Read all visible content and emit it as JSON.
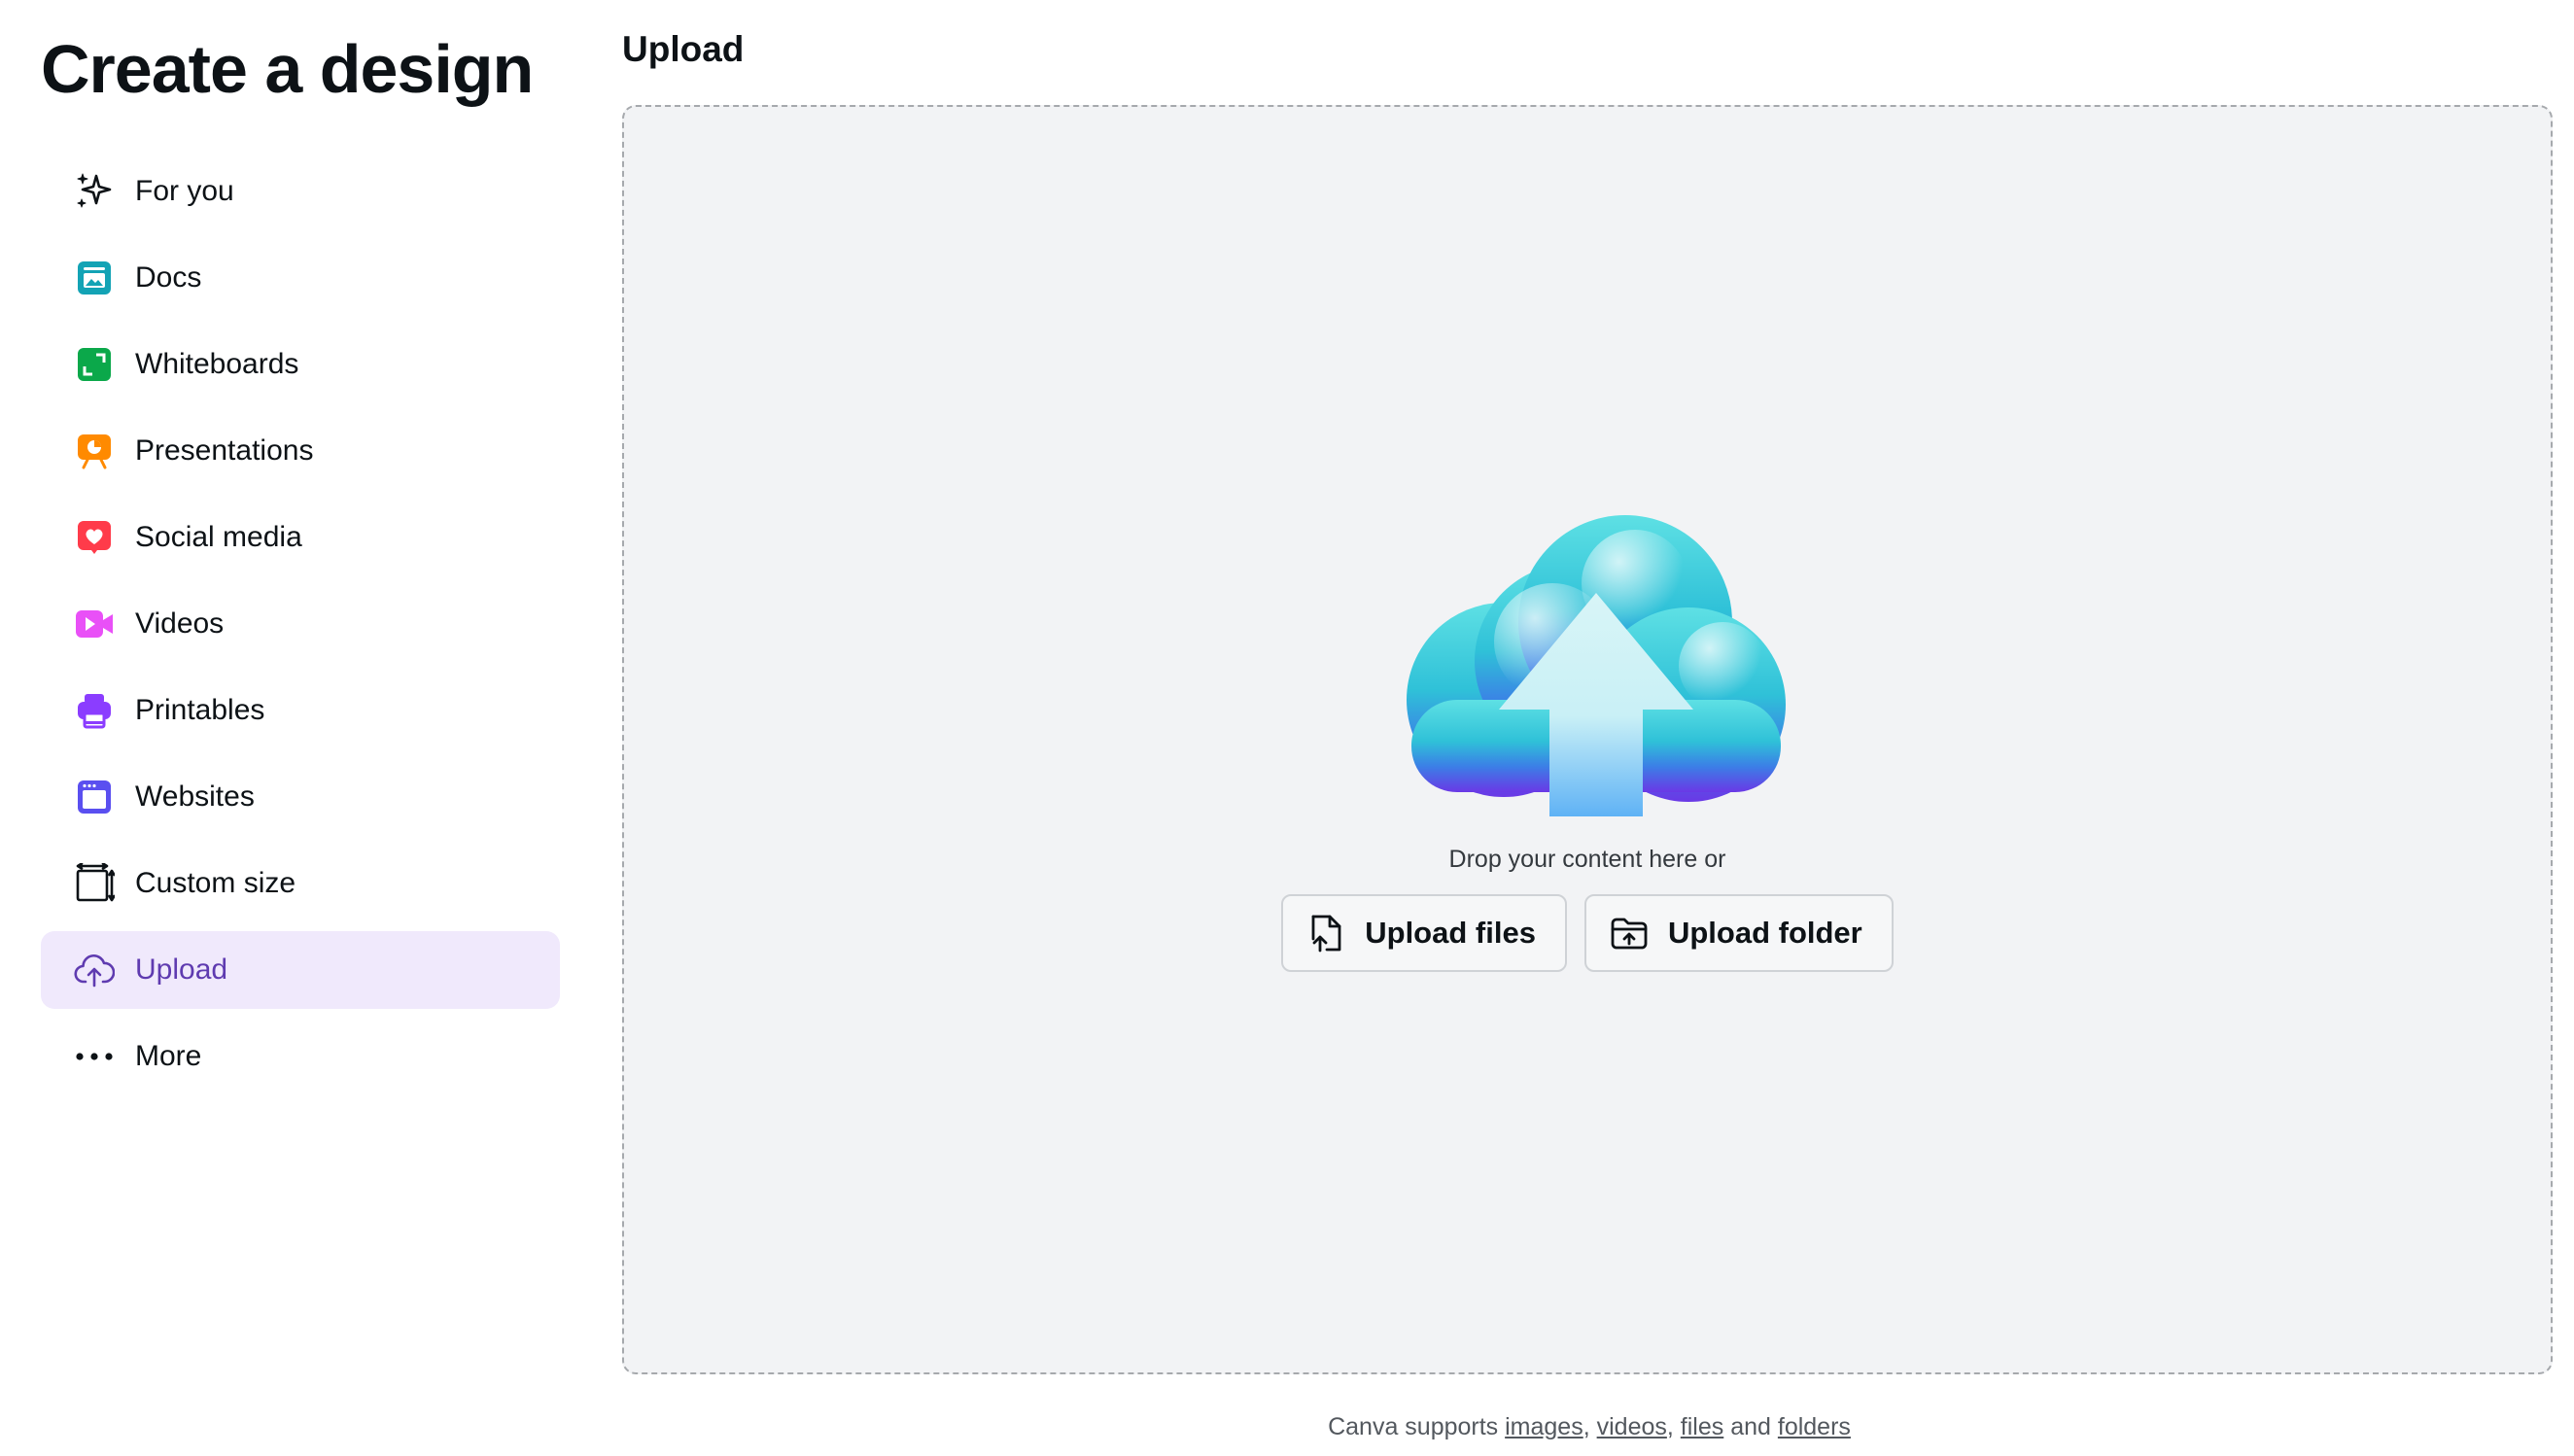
{
  "sidebar": {
    "title": "Create a design",
    "items": [
      {
        "label": "For you",
        "icon": "sparkle-icon",
        "color": "#0d1216"
      },
      {
        "label": "Docs",
        "icon": "docs-icon",
        "color": "#13a3b5"
      },
      {
        "label": "Whiteboards",
        "icon": "whiteboard-icon",
        "color": "#0ba84a"
      },
      {
        "label": "Presentations",
        "icon": "presentation-icon",
        "color": "#ff8a00"
      },
      {
        "label": "Social media",
        "icon": "heart-icon",
        "color": "#ff3b4a"
      },
      {
        "label": "Videos",
        "icon": "video-icon",
        "color": "#e950f7"
      },
      {
        "label": "Printables",
        "icon": "printer-icon",
        "color": "#8b3dff"
      },
      {
        "label": "Websites",
        "icon": "website-icon",
        "color": "#5a4ff0"
      },
      {
        "label": "Custom size",
        "icon": "custom-size-icon",
        "color": "#0d1216"
      },
      {
        "label": "Upload",
        "icon": "upload-cloud-icon",
        "color": "#5f3bb0",
        "active": true
      },
      {
        "label": "More",
        "icon": "more-dots-icon",
        "color": "#0d1216"
      }
    ]
  },
  "main": {
    "section_title": "Upload",
    "dropzone": {
      "prompt": "Drop your content here or",
      "upload_files_label": "Upload files",
      "upload_folder_label": "Upload folder"
    },
    "footer": {
      "prefix": "Canva supports ",
      "link_images": "images",
      "sep1": ", ",
      "link_videos": "videos",
      "sep2": ", ",
      "link_files": "files",
      "sep3": " and ",
      "link_folders": "folders"
    }
  },
  "colors": {
    "active_bg": "#f0e9fc",
    "active_text": "#5f3bb0",
    "dropzone_bg": "#f2f3f5"
  }
}
